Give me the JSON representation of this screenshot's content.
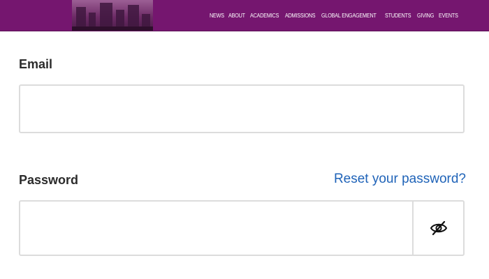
{
  "header": {
    "nav": [
      "NEWS",
      "ABOUT",
      "ACADEMICS",
      "ADMISSIONS",
      "GLOBAL ENGAGEMENT",
      "STUDENTS",
      "GIVING",
      "EVENTS"
    ]
  },
  "form": {
    "email_label": "Email",
    "email_value": "",
    "password_label": "Password",
    "password_value": "",
    "reset_link": "Reset your password?",
    "password_toggle_icon": "eye-slash-icon"
  },
  "colors": {
    "header_bg": "#75166f",
    "link": "#1f63b8",
    "border": "#dcdcdc"
  }
}
